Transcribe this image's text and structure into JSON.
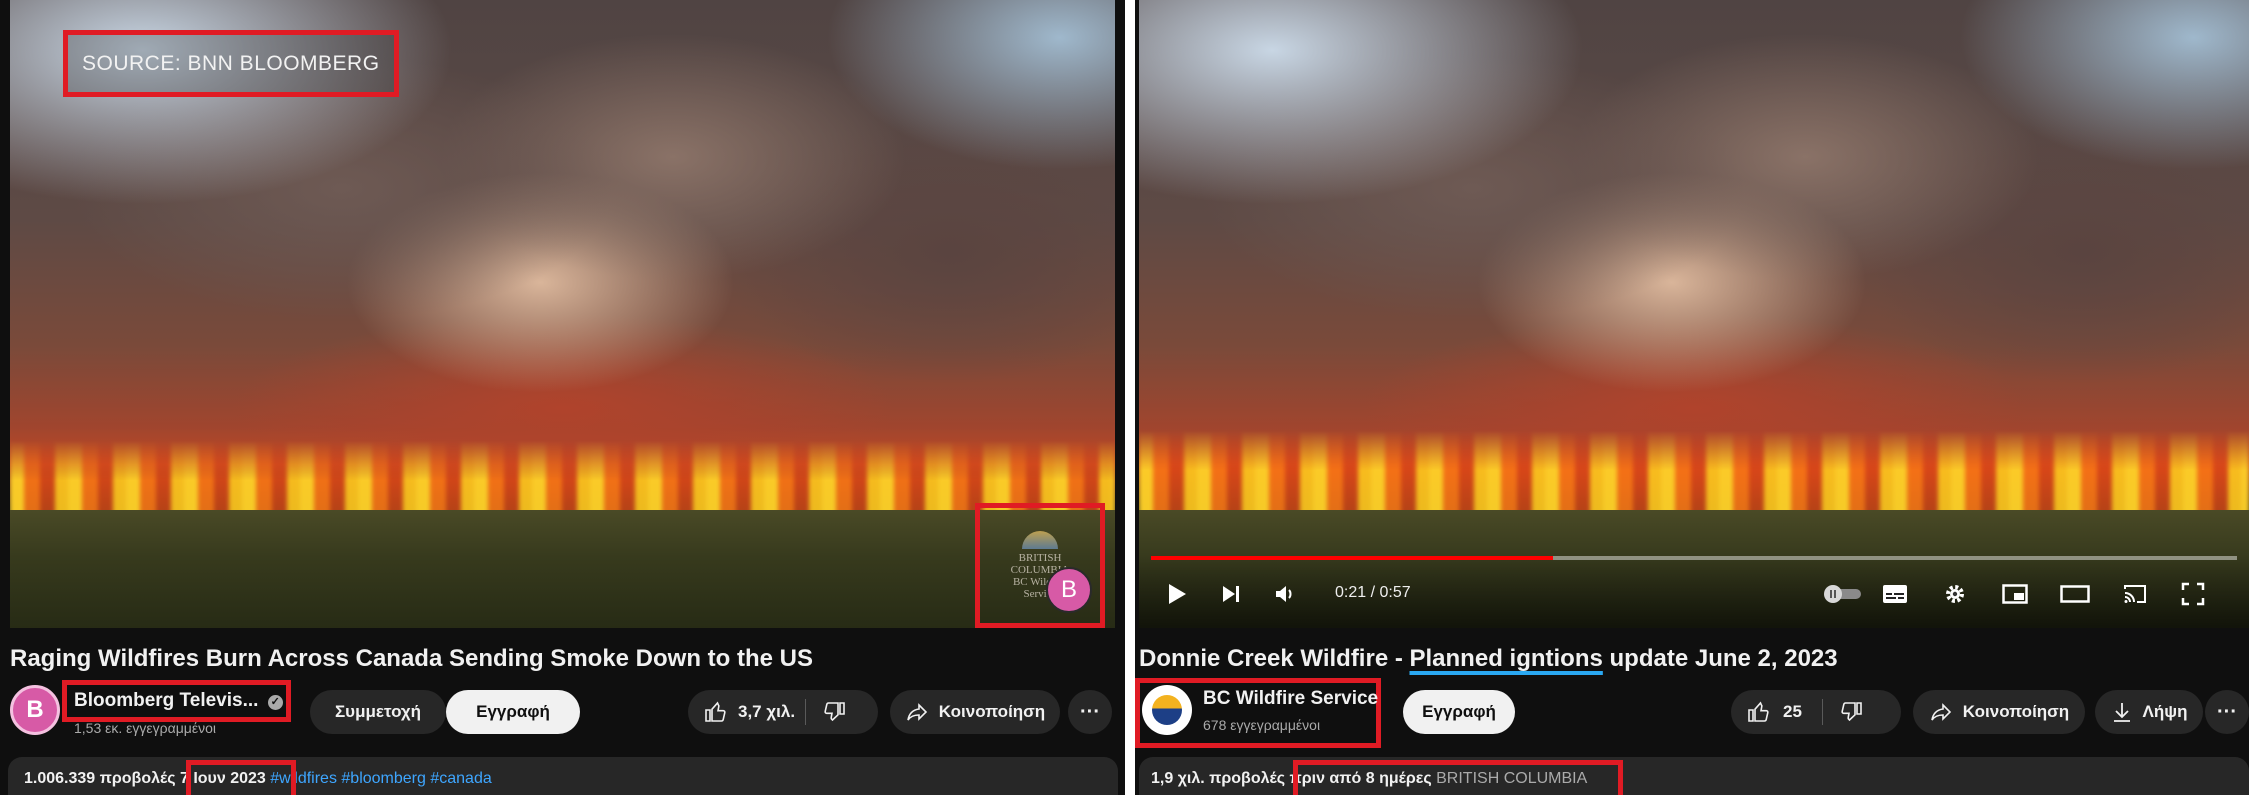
{
  "left": {
    "overlay_source": "SOURCE: BNN BLOOMBERG",
    "watermark_text": "BRITISH COLUMBIA\nBC Wildfire Service",
    "watermark_badge": "B",
    "title": "Raging Wildfires Burn Across Canada Sending Smoke Down to the US",
    "channel": {
      "avatar_letter": "B",
      "name": "Bloomberg Televis...",
      "subscribers": "1,53 εκ. εγγεγραμμένοι"
    },
    "buttons": {
      "join": "Συμμετοχή",
      "subscribe": "Εγγραφή",
      "likes": "3,7 χιλ.",
      "share": "Κοινοποίηση",
      "more": "···"
    },
    "description": {
      "views": "1.006.339 προβολές",
      "date": "7 Ιουν 2023",
      "tags": [
        "#wildfires",
        "#bloomberg",
        "#canada"
      ]
    }
  },
  "right": {
    "player": {
      "time": "0:21 / 0:57",
      "progress": 0.37
    },
    "title_before": "Donnie Creek Wildfire - ",
    "title_highlight": "Planned igntions",
    "title_after": " update June 2, 2023",
    "channel": {
      "name": "BC Wildfire Service",
      "subscribers": "678 εγγεγραμμένοι"
    },
    "buttons": {
      "subscribe": "Εγγραφή",
      "likes": "25",
      "share": "Κοινοποίηση",
      "download": "Λήψη",
      "more": "···"
    },
    "description": {
      "views": "1,9 χιλ. προβολές",
      "date": "πριν από 8 ημέρες",
      "location": "BRITISH COLUMBIA"
    }
  },
  "colors": {
    "annotation_red": "#e01b24",
    "link_blue": "#3ea6ff",
    "underline_blue": "#2aa8f2",
    "progress_red": "#ff0000"
  }
}
